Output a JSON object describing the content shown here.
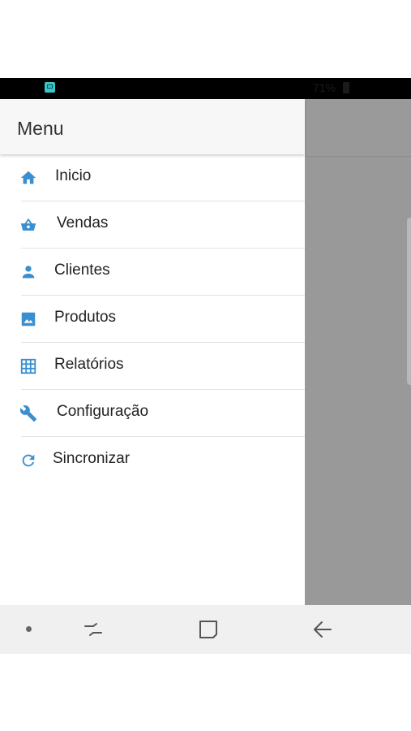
{
  "status_bar": {
    "battery_text": "71%"
  },
  "drawer": {
    "title": "Menu",
    "items": [
      {
        "label": "Inicio",
        "icon": "home-icon"
      },
      {
        "label": "Vendas",
        "icon": "basket-icon"
      },
      {
        "label": "Clientes",
        "icon": "person-icon"
      },
      {
        "label": "Produtos",
        "icon": "image-icon"
      },
      {
        "label": "Relatórios",
        "icon": "grid-icon"
      },
      {
        "label": "Configuração",
        "icon": "wrench-icon"
      },
      {
        "label": "Sincronizar",
        "icon": "refresh-icon"
      }
    ]
  },
  "colors": {
    "accent": "#3a8fd1",
    "overlay": "#999999",
    "header": "#f7f7f7"
  },
  "nav_bar": {
    "buttons": [
      "dot-icon",
      "recents-icon",
      "home-button-icon",
      "back-icon"
    ]
  }
}
